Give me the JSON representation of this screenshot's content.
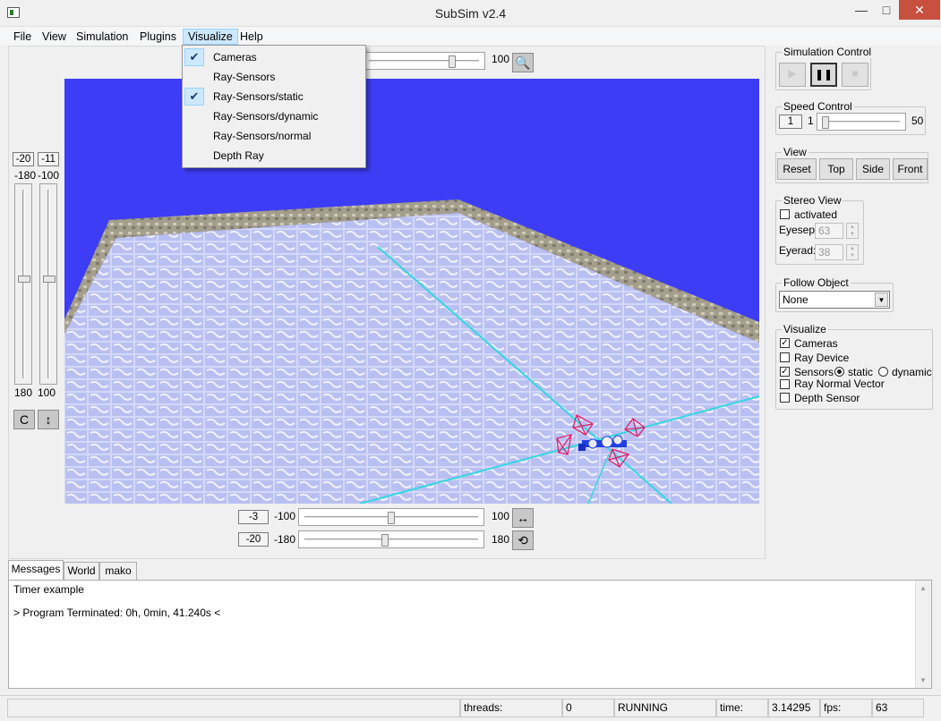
{
  "window": {
    "title": "SubSim v2.4",
    "minimize": "—",
    "maximize": "□",
    "close": "✕"
  },
  "menu": {
    "file": "File",
    "view": "View",
    "simulation": "Simulation",
    "plugins": "Plugins",
    "visualize": "Visualize",
    "help": "Help"
  },
  "visualize_menu": {
    "items": [
      {
        "label": "Cameras",
        "checked": true
      },
      {
        "label": "Ray-Sensors",
        "checked": false
      },
      {
        "label": "Ray-Sensors/static",
        "checked": true
      },
      {
        "label": "Ray-Sensors/dynamic",
        "checked": false
      },
      {
        "label": "Ray-Sensors/normal",
        "checked": false
      },
      {
        "label": "Depth Ray",
        "checked": false
      }
    ],
    "check_glyph": "✔"
  },
  "gl": {
    "zoom_max": "100",
    "left_spin_a": "-20",
    "left_spin_b": "-11",
    "left_min_a": "-180",
    "left_min_b": "-100",
    "left_max_a": "180",
    "left_max_b": "100",
    "left_btn_rotate": "C",
    "left_btn_updown": "↕",
    "bottom_spin_a": "-3",
    "bottom_min_a": "-100",
    "bottom_max_a": "100",
    "bottom_spin_b": "-20",
    "bottom_min_b": "-180",
    "bottom_max_b": "180",
    "btn_move_horiz": "↔",
    "btn_rotate_horiz": "⟲",
    "zoom_icon": "🔍"
  },
  "sim_control": {
    "title": "Simulation Control",
    "play": "▶",
    "pause": "❚❚",
    "stop": "■"
  },
  "speed_control": {
    "title": "Speed Control",
    "value": "1",
    "min": "1",
    "max": "50"
  },
  "view": {
    "title": "View",
    "reset": "Reset",
    "top": "Top",
    "side": "Side",
    "front": "Front"
  },
  "stereo": {
    "title": "Stereo View",
    "activated": "activated",
    "eyesep_label": "Eyesep:",
    "eyesep": "63",
    "eyerad_label": "Eyerad:",
    "eyerad": "38"
  },
  "follow": {
    "title": "Follow Object",
    "selected": "None"
  },
  "visualize_panel": {
    "title": "Visualize",
    "cameras": "Cameras",
    "ray_device": "Ray Device",
    "sensors": "Sensors",
    "static": "static",
    "dynamic": "dynamic",
    "ray_normal": "Ray Normal Vector",
    "depth_sensor": "Depth Sensor",
    "check": "✓"
  },
  "tabs": {
    "messages": "Messages",
    "world": "World",
    "mako": "mako"
  },
  "messages": {
    "line1": "Timer example",
    "line2": "> Program Terminated: 0h, 0min, 41.240s <"
  },
  "status": {
    "threads_label": "threads:",
    "threads": "0",
    "state": "RUNNING",
    "time_label": "time:",
    "time": "3.14295",
    "fps_label": "fps:",
    "fps": "63"
  },
  "colors": {
    "sky": "#3d3df5",
    "menu_highlight": "#cce8ff",
    "close": "#c7503f"
  }
}
